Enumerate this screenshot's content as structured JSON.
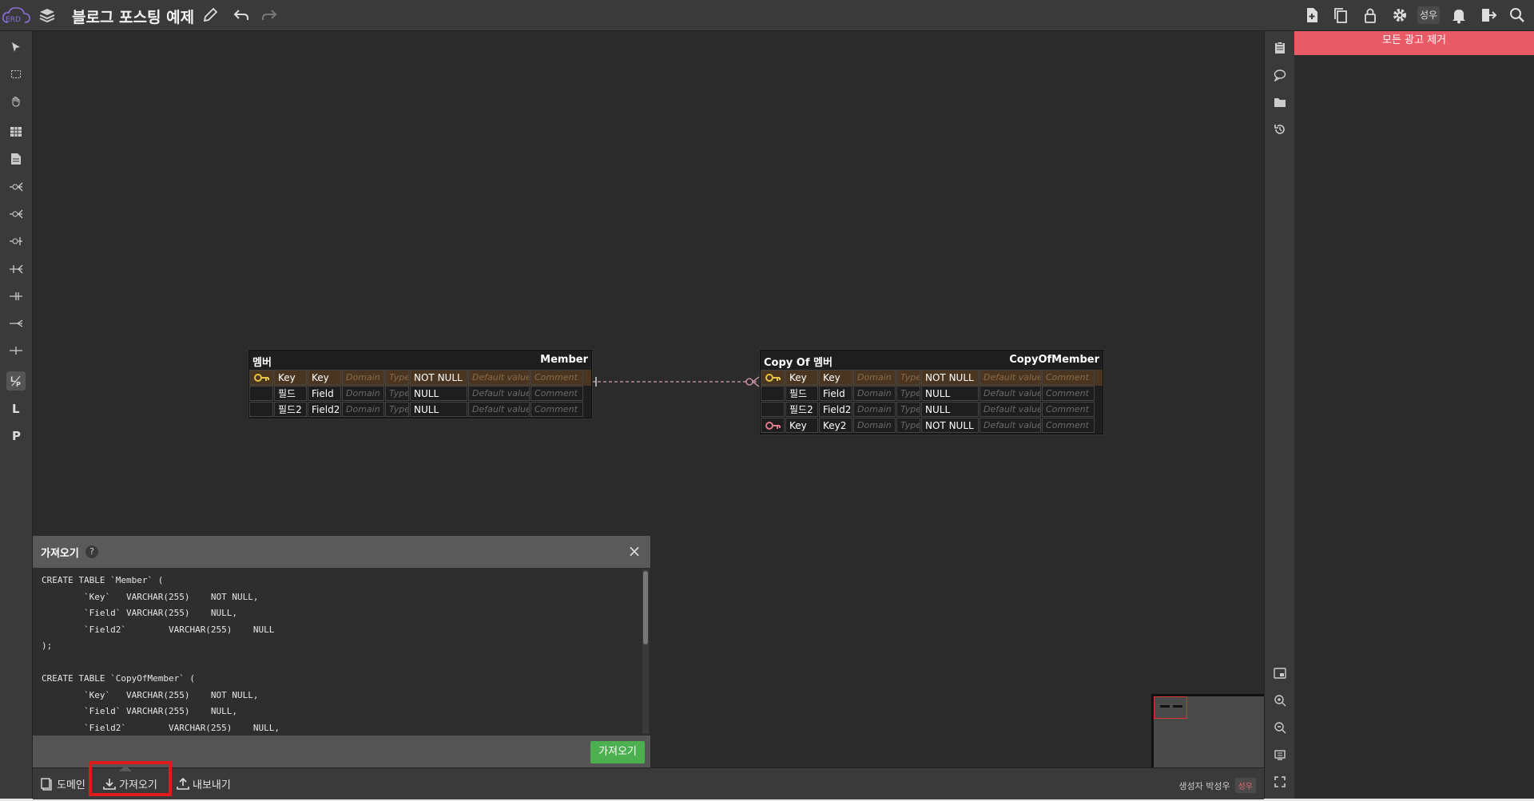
{
  "app": {
    "title": "블로그 포스팅 예제",
    "user_badge": "성우",
    "colors": {
      "accent_red": "#e85a66",
      "pk_row": "#4a3520",
      "import_button": "#4caf50",
      "highlight": "#e01b1b"
    }
  },
  "ad": {
    "remove_label": "모든 광고 제거"
  },
  "tables": {
    "member": {
      "logical_name": "멤버",
      "physical_name": "Member",
      "rows": [
        {
          "logical": "Key",
          "physical": "Key",
          "domain": "Domain",
          "type": "Type",
          "null": "NOT NULL",
          "default": "Default value",
          "comment": "Comment",
          "pk": true,
          "fk": false
        },
        {
          "logical": "필드",
          "physical": "Field",
          "domain": "Domain",
          "type": "Type",
          "null": "NULL",
          "default": "Default value",
          "comment": "Comment",
          "pk": false,
          "fk": false
        },
        {
          "logical": "필드2",
          "physical": "Field2",
          "domain": "Domain",
          "type": "Type",
          "null": "NULL",
          "default": "Default value",
          "comment": "Comment",
          "pk": false,
          "fk": false
        }
      ]
    },
    "copy": {
      "logical_name": "Copy Of 멤버",
      "physical_name": "CopyOfMember",
      "rows": [
        {
          "logical": "Key",
          "physical": "Key",
          "domain": "Domain",
          "type": "Type",
          "null": "NOT NULL",
          "default": "Default value",
          "comment": "Comment",
          "pk": true,
          "fk": false
        },
        {
          "logical": "필드",
          "physical": "Field",
          "domain": "Domain",
          "type": "Type",
          "null": "NULL",
          "default": "Default value",
          "comment": "Comment",
          "pk": false,
          "fk": false
        },
        {
          "logical": "필드2",
          "physical": "Field2",
          "domain": "Domain",
          "type": "Type",
          "null": "NULL",
          "default": "Default value",
          "comment": "Comment",
          "pk": false,
          "fk": false
        },
        {
          "logical": "Key",
          "physical": "Key2",
          "domain": "Domain",
          "type": "Type",
          "null": "NOT NULL",
          "default": "Default value",
          "comment": "Comment",
          "pk": false,
          "fk": true
        }
      ]
    }
  },
  "import_panel": {
    "title": "가져오기",
    "help": "?",
    "code": "CREATE TABLE `Member` (\n\t`Key`\tVARCHAR(255)\tNOT NULL,\n\t`Field`\tVARCHAR(255)\tNULL,\n\t`Field2`\tVARCHAR(255)\tNULL\n);\n\nCREATE TABLE `CopyOfMember` (\n\t`Key`\tVARCHAR(255)\tNOT NULL,\n\t`Field`\tVARCHAR(255)\tNULL,\n\t`Field2`\tVARCHAR(255)\tNULL,",
    "button": "가져오기"
  },
  "bottom": {
    "domain": "도메인",
    "import": "가져오기",
    "export": "내보내기",
    "creator_label": "생성자 박성우",
    "creator_badge": "성우"
  },
  "left_tools": [
    "pointer-icon",
    "selection-icon",
    "hand-icon",
    "table-icon",
    "memo-icon",
    "rel-zero-many-icon",
    "rel-one-many-icon",
    "rel-zero-one-icon",
    "rel-one-only-icon",
    "rel-one-one-icon",
    "rel-many-icon",
    "rel-line-icon",
    "logical-physical-icon",
    "logical-icon",
    "physical-icon"
  ]
}
